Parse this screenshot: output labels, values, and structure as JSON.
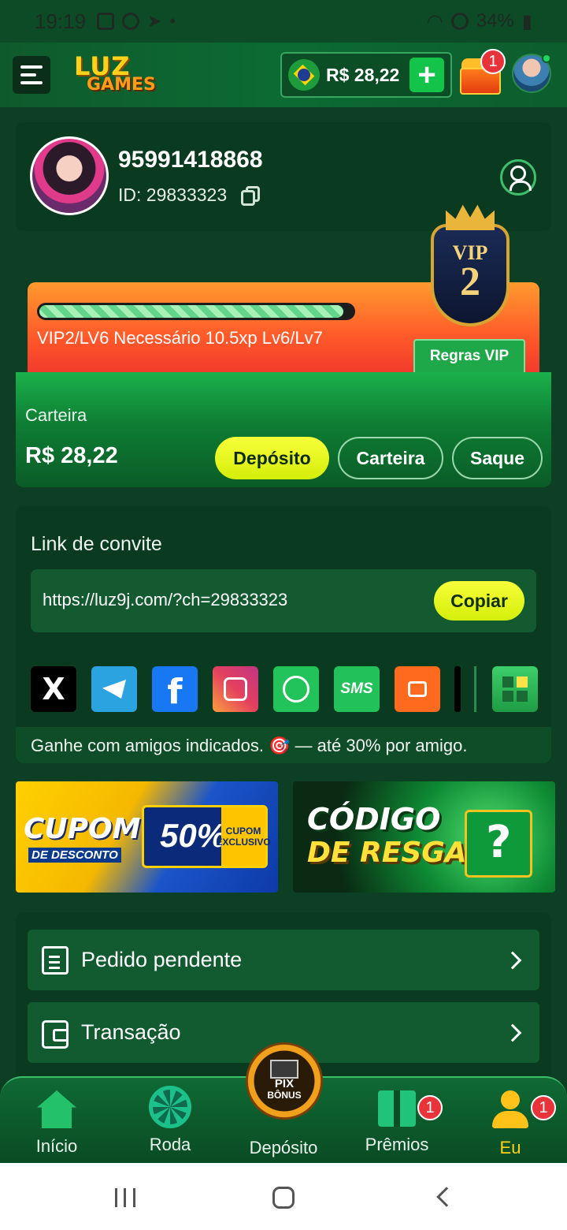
{
  "status_bar": {
    "time": "19:19",
    "battery": "34%"
  },
  "header": {
    "logo_line1": "LUZ",
    "logo_line2": "GAMES",
    "balance": "R$ 28,22",
    "chest_badge": "1"
  },
  "profile": {
    "phone": "95991418868",
    "id_text": "ID: 29833323"
  },
  "vip": {
    "status_text": "VIP2/LV6  Necessário 10.5xp Lv6/Lv7",
    "rules_label": "Regras VIP",
    "badge_label": "VIP",
    "badge_level": "2",
    "progress_fraction": 0.97
  },
  "wallet": {
    "label": "Carteira",
    "amount": "R$ 28,22",
    "deposit_label": "Depósito",
    "wallet_label": "Carteira",
    "withdraw_label": "Saque"
  },
  "invite": {
    "title": "Link de convite",
    "link": "https://luz9j.com/?ch=29833323",
    "copy_label": "Copiar",
    "footer": "Ganhe com amigos indicados. 🎯 — até 30% por amigo.",
    "socials": [
      "x-icon",
      "telegram-icon",
      "facebook-icon",
      "instagram-icon",
      "whatsapp-icon",
      "sms-icon",
      "kwai-icon",
      "more-icon",
      "apps-icon"
    ],
    "sms_text": "SMS",
    "x_text": "X",
    "fb_text": "f"
  },
  "banners": {
    "coupon_title": "CUPOM",
    "coupon_sub": "DE DESCONTO",
    "coupon_pct": "50%",
    "coupon_side": "CUPOM EXCLUSIVO",
    "redeem_title1": "CÓDIGO",
    "redeem_title2": "DE RESGATE"
  },
  "menu": {
    "items": [
      {
        "label": "Pedido pendente"
      },
      {
        "label": "Transação"
      }
    ]
  },
  "bottom_nav": {
    "home": "Início",
    "wheel": "Roda",
    "deposit": "Depósito",
    "prizes": "Prêmios",
    "me": "Eu",
    "prizes_badge": "1",
    "me_badge": "1",
    "center_pix": "PIX",
    "center_bonus": "BÔNUS"
  },
  "colors": {
    "background": "#0c3f23",
    "accent_yellow": "#e8f51a",
    "accent_green": "#1bb14b",
    "vip_orange": "#ff7a2c",
    "badge_red": "#e8333a"
  }
}
